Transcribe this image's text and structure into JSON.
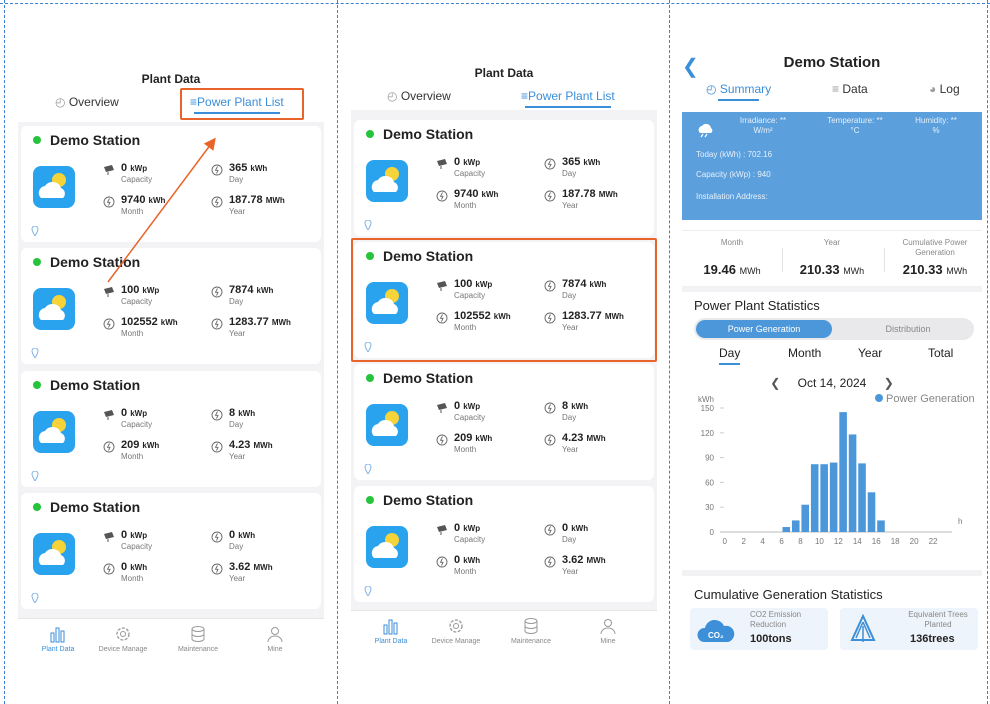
{
  "colors": {
    "accent": "#3b8ed8",
    "highlight": "#e8642a",
    "online": "#25c43c",
    "panel": "#5b9fdc",
    "bar": "#4b97d9"
  },
  "list_screen": {
    "title": "Plant Data",
    "tab_overview": "Overview",
    "tab_power_list": "Power Plant List",
    "stations": [
      {
        "name": "Demo Station",
        "capacity_value": "0",
        "capacity_unit": "kWp",
        "capacity_label": "Capacity",
        "day_value": "365",
        "day_unit": "kWh",
        "day_label": "Day",
        "month_value": "9740",
        "month_unit": "kWh",
        "month_label": "Month",
        "year_value": "187.78",
        "year_unit": "MWh",
        "year_label": "Year"
      },
      {
        "name": "Demo Station",
        "capacity_value": "100",
        "capacity_unit": "kWp",
        "capacity_label": "Capacity",
        "day_value": "7874",
        "day_unit": "kWh",
        "day_label": "Day",
        "month_value": "102552",
        "month_unit": "kWh",
        "month_label": "Month",
        "year_value": "1283.77",
        "year_unit": "MWh",
        "year_label": "Year"
      },
      {
        "name": "Demo Station",
        "capacity_value": "0",
        "capacity_unit": "kWp",
        "capacity_label": "Capacity",
        "day_value": "8",
        "day_unit": "kWh",
        "day_label": "Day",
        "month_value": "209",
        "month_unit": "kWh",
        "month_label": "Month",
        "year_value": "4.23",
        "year_unit": "MWh",
        "year_label": "Year"
      },
      {
        "name": "Demo Station",
        "capacity_value": "0",
        "capacity_unit": "kWp",
        "capacity_label": "Capacity",
        "day_value": "0",
        "day_unit": "kWh",
        "day_label": "Day",
        "month_value": "0",
        "month_unit": "kWh",
        "month_label": "Month",
        "year_value": "3.62",
        "year_unit": "MWh",
        "year_label": "Year"
      }
    ],
    "tabbar": [
      {
        "label": "Plant Data",
        "icon": "bar-chart-icon"
      },
      {
        "label": "Device Manage",
        "icon": "gear-icon"
      },
      {
        "label": "Maintenance",
        "icon": "database-icon"
      },
      {
        "label": "Mine",
        "icon": "user-icon"
      }
    ]
  },
  "detail_screen": {
    "title": "Demo Station",
    "tabs": [
      "Summary",
      "Data",
      "Log"
    ],
    "weather": {
      "irradiance_label": "Irradiance: **",
      "irradiance_unit": "W/m²",
      "temperature_label": "Temperature: **",
      "temperature_unit": "°C",
      "humidity_label": "Humidity: **",
      "humidity_unit": "%"
    },
    "today": "Today (kWh) : 702.16",
    "capacity": "Capacity (kWp) : 940",
    "address": "Installation Address:",
    "metrics": [
      {
        "label": "Month",
        "value": "19.46",
        "unit": "MWh"
      },
      {
        "label": "Year",
        "value": "210.33",
        "unit": "MWh"
      },
      {
        "label": "Cumulative Power Generation",
        "value": "210.33",
        "unit": "MWh"
      }
    ],
    "stats_title": "Power Plant Statistics",
    "seg_a": "Power Generation",
    "seg_b": "Distribution",
    "periods": [
      "Day",
      "Month",
      "Year",
      "Total"
    ],
    "date": "Oct 14, 2024",
    "cum_title": "Cumulative Generation Statistics",
    "co2_label": "CO2 Emission Reduction",
    "co2_value": "100tons",
    "co2_icon_text": "CO₂",
    "trees_label": "Equivalent Trees Planted",
    "trees_value": "136trees"
  },
  "chart_data": {
    "type": "bar",
    "title": "",
    "ylabel": "kWh",
    "xlabel": "h",
    "legend": "Power Generation",
    "legend_position": "top-right",
    "ylim": [
      0,
      150
    ],
    "yticks": [
      0,
      30,
      60,
      90,
      120,
      150
    ],
    "xticks": [
      0,
      2,
      4,
      6,
      8,
      10,
      12,
      14,
      16,
      18,
      20,
      22
    ],
    "x": [
      6.5,
      7.5,
      8.5,
      9.5,
      10.5,
      11.5,
      12.5,
      13.5,
      14.5,
      15.5,
      16.5
    ],
    "values": [
      6,
      14,
      33,
      82,
      82,
      84,
      145,
      118,
      83,
      48,
      14
    ]
  }
}
